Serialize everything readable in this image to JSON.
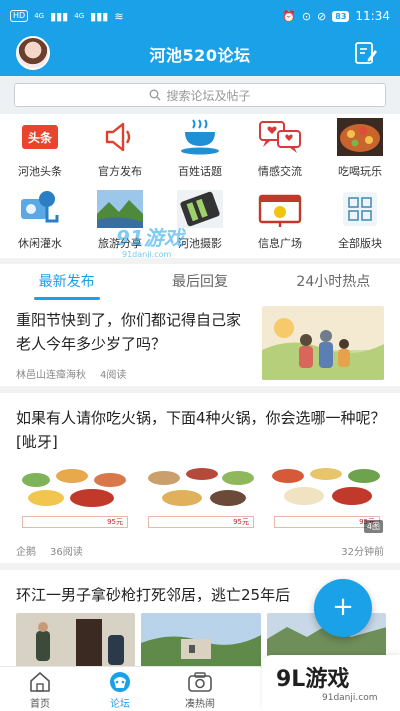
{
  "status_bar": {
    "network_badge": "HD",
    "signal_1": "4G",
    "signal_2": "4G",
    "battery": "83",
    "time": "11:34"
  },
  "header": {
    "title": "河池520论坛"
  },
  "search": {
    "placeholder": "搜索论坛及帖子"
  },
  "categories": [
    {
      "label": "河池头条",
      "icon": "toutiao-icon"
    },
    {
      "label": "官方发布",
      "icon": "megaphone-icon"
    },
    {
      "label": "百姓话题",
      "icon": "coffee-cup-icon"
    },
    {
      "label": "情感交流",
      "icon": "chat-hearts-icon"
    },
    {
      "label": "吃喝玩乐",
      "icon": "food-plate-icon"
    },
    {
      "label": "休闲灌水",
      "icon": "water-icon"
    },
    {
      "label": "旅游分享",
      "icon": "landscape-icon"
    },
    {
      "label": "河池摄影",
      "icon": "film-camera-icon"
    },
    {
      "label": "信息广场",
      "icon": "info-board-icon"
    },
    {
      "label": "全部版块",
      "icon": "grid-icon"
    }
  ],
  "tabs": [
    {
      "label": "最新发布",
      "active": true
    },
    {
      "label": "最后回复",
      "active": false
    },
    {
      "label": "24小时热点",
      "active": false
    }
  ],
  "posts": [
    {
      "title": "重阳节快到了，你们都记得自己家老人今年多少岁了吗？",
      "author": "林邑山连瘴海秋",
      "reads": "4阅读"
    },
    {
      "title": "如果有人请你吃火锅，下面4种火锅，你会选哪一种呢？[呲牙]",
      "author": "企鹅",
      "reads": "36阅读",
      "time": "32分钟前",
      "image_count": "4图",
      "price_tag": "95元"
    },
    {
      "title": "环江一男子拿砂枪打死邻居，逃亡25年后"
    }
  ],
  "bottom_nav": [
    {
      "label": "首页",
      "icon": "home-icon",
      "active": false
    },
    {
      "label": "论坛",
      "icon": "forum-icon",
      "active": true
    },
    {
      "label": "凑热闹",
      "icon": "camera-icon",
      "active": false
    }
  ],
  "watermarks": {
    "center_big": "91游戏",
    "center_small": "91danji.com",
    "corner_big": "9L游戏",
    "corner_small": "91danji.com"
  },
  "fab": {
    "label": "+"
  }
}
